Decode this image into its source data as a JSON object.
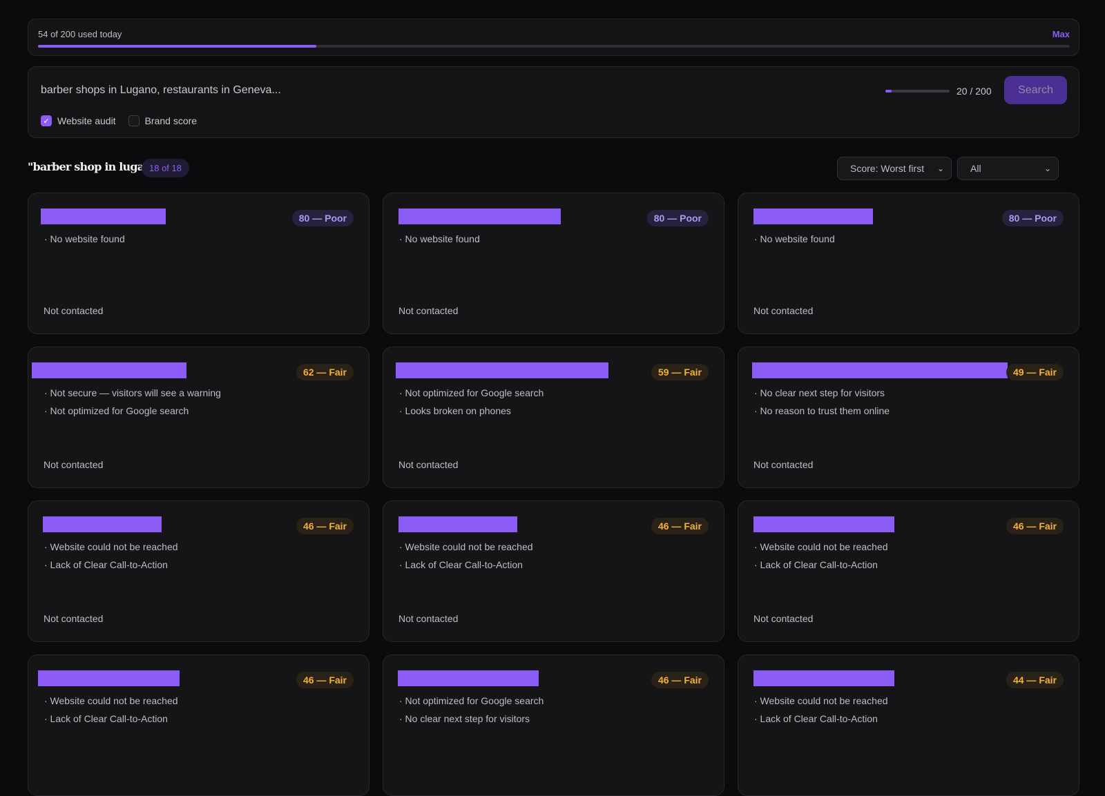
{
  "usage": {
    "text": "54 of 200 used today",
    "max_label": "Max",
    "used": 54,
    "limit": 200
  },
  "search": {
    "placeholder": "barber shops in Lugano, restaurants in Geneva...",
    "result_count": "20 / 200",
    "result_fraction": 0.1,
    "button_label": "Search",
    "options": [
      {
        "label": "Website audit",
        "checked": true
      },
      {
        "label": "Brand score",
        "checked": false
      }
    ]
  },
  "results": {
    "query_title": "\"barber shop in lugano\"",
    "count_badge": "18 of 18",
    "sort_select": "Score: Worst first",
    "filter_select": "All",
    "cards": [
      {
        "score": "80 — Poor",
        "level": "poor",
        "issues": [
          "· No website found"
        ],
        "status": "Not contacted"
      },
      {
        "score": "80 — Poor",
        "level": "poor",
        "issues": [
          "· No website found"
        ],
        "status": "Not contacted"
      },
      {
        "score": "80 — Poor",
        "level": "poor",
        "issues": [
          "· No website found"
        ],
        "status": "Not contacted"
      },
      {
        "score": "62 — Fair",
        "level": "fair",
        "issues": [
          "· Not secure — visitors will see a warning",
          "· Not optimized for Google search"
        ],
        "status": "Not contacted"
      },
      {
        "score": "59 — Fair",
        "level": "fair",
        "issues": [
          "· Not optimized for Google search",
          "· Looks broken on phones"
        ],
        "status": "Not contacted"
      },
      {
        "score": "49 — Fair",
        "level": "fair",
        "issues": [
          "· No clear next step for visitors",
          "· No reason to trust them online"
        ],
        "status": "Not contacted"
      },
      {
        "score": "46 — Fair",
        "level": "fair",
        "issues": [
          "· Website could not be reached",
          "· Lack of Clear Call-to-Action"
        ],
        "status": "Not contacted"
      },
      {
        "score": "46 — Fair",
        "level": "fair",
        "issues": [
          "· Website could not be reached",
          "· Lack of Clear Call-to-Action"
        ],
        "status": "Not contacted"
      },
      {
        "score": "46 — Fair",
        "level": "fair",
        "issues": [
          "· Website could not be reached",
          "· Lack of Clear Call-to-Action"
        ],
        "status": "Not contacted"
      },
      {
        "score": "46 — Fair",
        "level": "fair",
        "issues": [
          "· Website could not be reached",
          "· Lack of Clear Call-to-Action"
        ],
        "status": ""
      },
      {
        "score": "46 — Fair",
        "level": "fair",
        "issues": [
          "· Not optimized for Google search",
          "· No clear next step for visitors"
        ],
        "status": ""
      },
      {
        "score": "44 — Fair",
        "level": "fair",
        "issues": [
          "· Website could not be reached",
          "· Lack of Clear Call-to-Action"
        ],
        "status": ""
      }
    ]
  },
  "colors": {
    "accent": "#8b5cf6",
    "poor": "#a99bf0",
    "fair": "#f2b13a",
    "background": "#0b0b0e"
  }
}
